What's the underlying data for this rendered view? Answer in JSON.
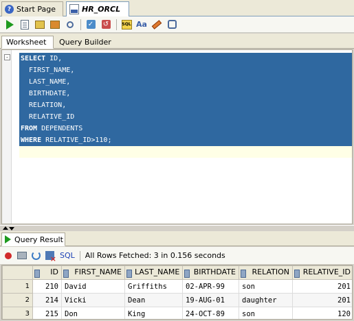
{
  "doc_tabs": [
    {
      "label": "Start Page"
    },
    {
      "label": "HR_ORCL"
    }
  ],
  "toolbar": {
    "buttons": [
      "run-statement",
      "run-script",
      "commit",
      "rollback",
      "autotrace",
      "explain-plan",
      "sql-worksheet-history",
      "uppercase",
      "clear",
      "history"
    ]
  },
  "editor": {
    "tabs": [
      {
        "label": "Worksheet"
      },
      {
        "label": "Query Builder"
      }
    ],
    "lines": [
      {
        "kw": "SELECT",
        "rest": " ID,"
      },
      {
        "kw": "",
        "rest": "  FIRST_NAME,"
      },
      {
        "kw": "",
        "rest": "  LAST_NAME,"
      },
      {
        "kw": "",
        "rest": "  BIRTHDATE,"
      },
      {
        "kw": "",
        "rest": "  RELATION,"
      },
      {
        "kw": "",
        "rest": "  RELATIVE_ID"
      },
      {
        "kw": "FROM",
        "rest": " DEPENDENTS"
      },
      {
        "kw": "WHERE",
        "rest": " RELATIVE_ID>110;"
      }
    ],
    "fold_marker": "-"
  },
  "results": {
    "tab_label": "Query Result",
    "sql_link": "SQL",
    "status": "All Rows Fetched: 3 in 0.156 seconds",
    "columns": [
      "ID",
      "FIRST_NAME",
      "LAST_NAME",
      "BIRTHDATE",
      "RELATION",
      "RELATIVE_ID"
    ],
    "rows": [
      {
        "n": "1",
        "id": "210",
        "first": "David",
        "last": "Griffiths",
        "birth": "02-APR-99",
        "rel": "son",
        "relid": "201"
      },
      {
        "n": "2",
        "id": "214",
        "first": "Vicki",
        "last": "Dean",
        "birth": "19-AUG-01",
        "rel": "daughter",
        "relid": "201"
      },
      {
        "n": "3",
        "id": "215",
        "first": "Don",
        "last": "King",
        "birth": "24-OCT-89",
        "rel": "son",
        "relid": "120"
      }
    ]
  },
  "colors": {
    "selection": "#2f68a0",
    "run_green": "#1f9a1f"
  }
}
